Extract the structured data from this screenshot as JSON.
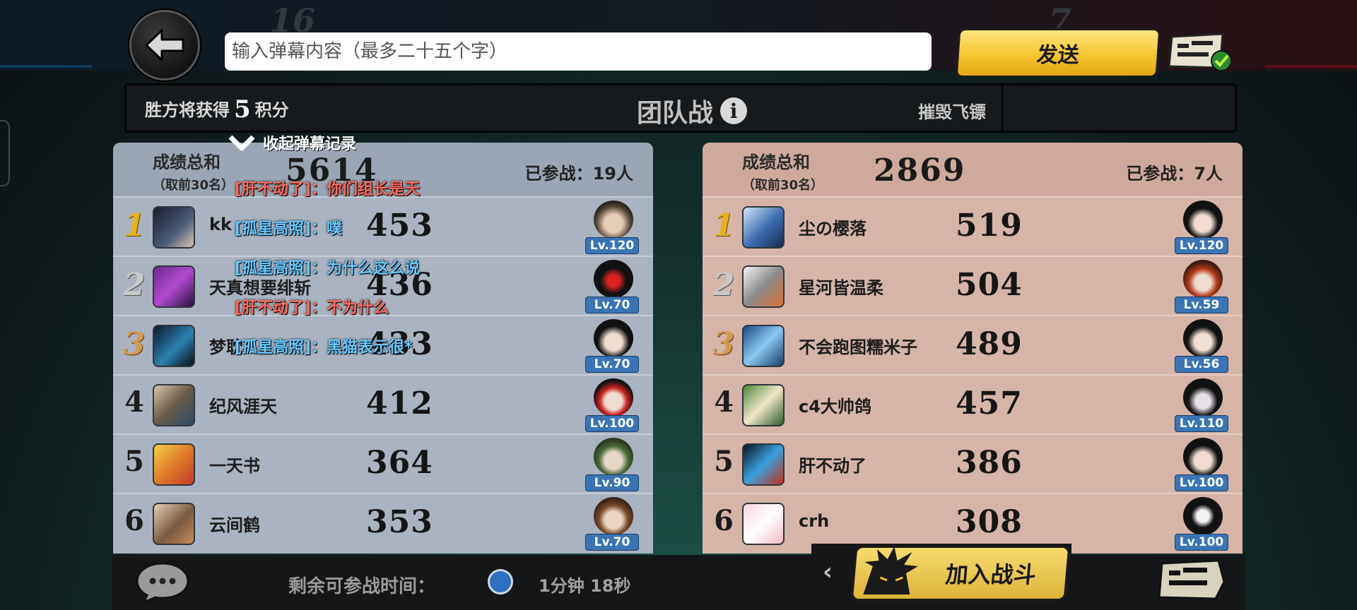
{
  "top": {
    "back_icon": "arrow-left-icon",
    "input_placeholder": "输入弹幕内容（最多二十五个字）",
    "send_label": "发送",
    "toggle_icon": "danmaku-toggle-icon",
    "score_left": "16",
    "score_right": "7"
  },
  "info": {
    "reward_prefix": "胜方将获得",
    "reward_points": "5",
    "reward_suffix": "积分",
    "mode": "团队战",
    "info_icon": "i",
    "objective": "摧毁飞镖"
  },
  "danmaku": {
    "collapse_label": "收起弹幕记录",
    "messages": [
      {
        "text": "[肝不动了]：你们组长是天",
        "color": "red"
      },
      {
        "text": "[孤星高照]：噗",
        "color": "blue"
      },
      {
        "text": "[孤星高照]：为什么这么说",
        "color": "blue"
      },
      {
        "text": "[肝不动了]：不为什么",
        "color": "red"
      },
      {
        "text": "[孤星高照]：黑猫表示很*",
        "color": "blue"
      }
    ]
  },
  "left_team": {
    "total_label": "成绩总和",
    "total_sub": "（取前30名）",
    "total": "5614",
    "joined": "已参战：19人",
    "players": [
      {
        "rank": "1",
        "name": "kk",
        "score": "453",
        "level": "Lv.120"
      },
      {
        "rank": "2",
        "name": "天真想要绯斩",
        "score": "436",
        "level": "Lv.70"
      },
      {
        "rank": "3",
        "name": "梦耽",
        "score": "433",
        "level": "Lv.70"
      },
      {
        "rank": "4",
        "name": "纪风涯天",
        "score": "412",
        "level": "Lv.100"
      },
      {
        "rank": "5",
        "name": "一天书",
        "score": "364",
        "level": "Lv.90"
      },
      {
        "rank": "6",
        "name": "云间鹤",
        "score": "353",
        "level": "Lv.70"
      }
    ]
  },
  "right_team": {
    "total_label": "成绩总和",
    "total_sub": "（取前30名）",
    "total": "2869",
    "joined": "已参战：7人",
    "players": [
      {
        "rank": "1",
        "name": "尘の樱落",
        "score": "519",
        "level": "Lv.120"
      },
      {
        "rank": "2",
        "name": "星河皆温柔",
        "score": "504",
        "level": "Lv.59"
      },
      {
        "rank": "3",
        "name": "不会跑图糯米子",
        "score": "489",
        "level": "Lv.56"
      },
      {
        "rank": "4",
        "name": "c4大帅鸽",
        "score": "457",
        "level": "Lv.110"
      },
      {
        "rank": "5",
        "name": "肝不动了",
        "score": "386",
        "level": "Lv.100"
      },
      {
        "rank": "6",
        "name": "crh",
        "score": "308",
        "level": "Lv.100"
      }
    ]
  },
  "bottom": {
    "chat_icon": "chat-bubble-icon",
    "time_label": "剩余可参战时间：",
    "clock_icon": "clock-icon",
    "time_value": "1分钟 18秒",
    "expand_icon": "‹",
    "join_label": "加入战斗",
    "danmaku_icon": "danmaku-toggle-icon"
  },
  "colors": {
    "left_team": "#a9b3c1",
    "right_team": "#d6b4a8",
    "accent_yellow": "#f4c22b",
    "level_blue": "#3a74b4",
    "danmaku_blue": "#69c7ff",
    "danmaku_red": "#ff6a5e"
  }
}
